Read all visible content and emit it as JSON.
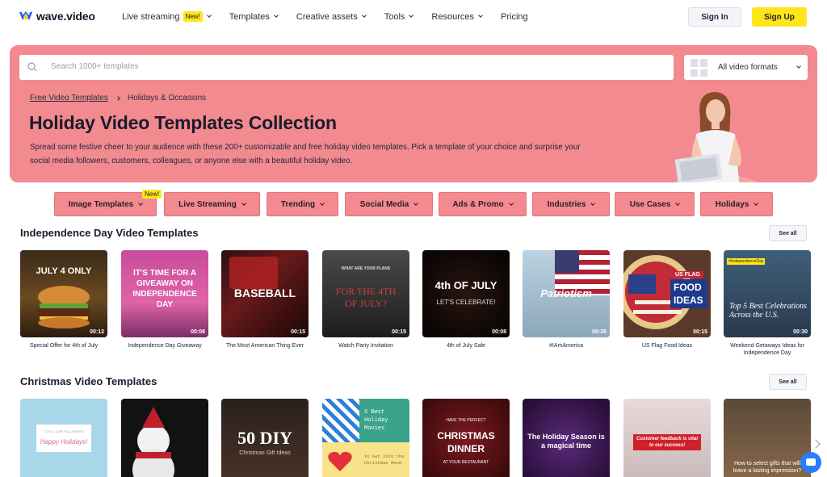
{
  "brand": {
    "name": "wave.video"
  },
  "nav": [
    {
      "label": "Live streaming",
      "badge": "New!",
      "dropdown": true
    },
    {
      "label": "Templates",
      "dropdown": true
    },
    {
      "label": "Creative assets",
      "dropdown": true
    },
    {
      "label": "Tools",
      "dropdown": true
    },
    {
      "label": "Resources",
      "dropdown": true
    },
    {
      "label": "Pricing",
      "dropdown": false
    }
  ],
  "auth": {
    "signin": "Sign In",
    "signup": "Sign Up"
  },
  "hero": {
    "search_placeholder": "Search 1000+ templates",
    "formats_label": "All video formats",
    "breadcrumb": [
      "Free Video Templates",
      "Holidays & Occasions"
    ],
    "title": "Holiday Video Templates Collection",
    "description": "Spread some festive cheer to your audience with these 200+ customizable and free holiday video templates. Pick a template of your choice and surprise your social media followers, customers, colleagues, or anyone else with a beautiful holiday video.",
    "bg_color": "#f28a8f"
  },
  "categories": [
    {
      "label": "Image Templates",
      "badge": "New!"
    },
    {
      "label": "Live Streaming"
    },
    {
      "label": "Trending"
    },
    {
      "label": "Social Media"
    },
    {
      "label": "Ads & Promo"
    },
    {
      "label": "Industries"
    },
    {
      "label": "Use Cases"
    },
    {
      "label": "Holidays"
    }
  ],
  "sections": [
    {
      "title": "Independence Day Video Templates",
      "see_all": "See all",
      "cards": [
        {
          "caption": "Special Offer for 4th of July",
          "duration": "00:12",
          "overlay": "JULY 4 ONLY"
        },
        {
          "caption": "Independence Day Giveaway",
          "duration": "00:08",
          "overlay": "IT'S TIME FOR A GIVEAWAY ON INDEPENDENCE DAY"
        },
        {
          "caption": "The Most American Thing Ever",
          "duration": "00:15",
          "overlay": "BASEBALL"
        },
        {
          "caption": "Watch Party Invitation",
          "duration": "00:15",
          "overlay": "FOR THE 4TH OF JULY?",
          "overlay_small": "WHAT ARE YOUR PLANS"
        },
        {
          "caption": "4th of July Sale",
          "duration": "00:08",
          "overlay": "4th OF JULY",
          "overlay_small": "LET'S CELEBRATE!"
        },
        {
          "caption": "#IAmAmerica",
          "duration": "00:26",
          "overlay": "Patriotism"
        },
        {
          "caption": "US Flag Food Ideas",
          "duration": "00:15",
          "overlay": "FOOD IDEAS",
          "overlay_small": "US FLAG"
        },
        {
          "caption": "Weekend Getaways Ideas for Independence Day",
          "duration": "00:30",
          "overlay": "Top 5 Best Celebrations Across the U.S.",
          "overlay_small": "#IndependenceDay"
        }
      ]
    },
    {
      "title": "Christmas Video Templates",
      "see_all": "See all",
      "cards": [
        {
          "caption": "",
          "overlay": "Happy Holidays!",
          "overlay_small": "TO ALL OUR FOLLOWERS"
        },
        {
          "caption": "",
          "overlay": ""
        },
        {
          "caption": "",
          "overlay": "50 DIY",
          "overlay_small": "Christmas Gift Ideas"
        },
        {
          "caption": "",
          "overlay": "5 Best Holiday Movies",
          "overlay_small": "to Get Into the Christmas Mood"
        },
        {
          "caption": "",
          "overlay": "CHRISTMAS DINNER",
          "overlay_small": "HAVE THE PERFECT",
          "overlay_small2": "AT YOUR RESTAURANT"
        },
        {
          "caption": "",
          "overlay": "The Holiday Season is a magical time"
        },
        {
          "caption": "",
          "overlay": "Customer feedback is vital to our success!"
        },
        {
          "caption": "",
          "overlay": "How to select gifts that will leave a lasting impression?"
        }
      ]
    }
  ]
}
